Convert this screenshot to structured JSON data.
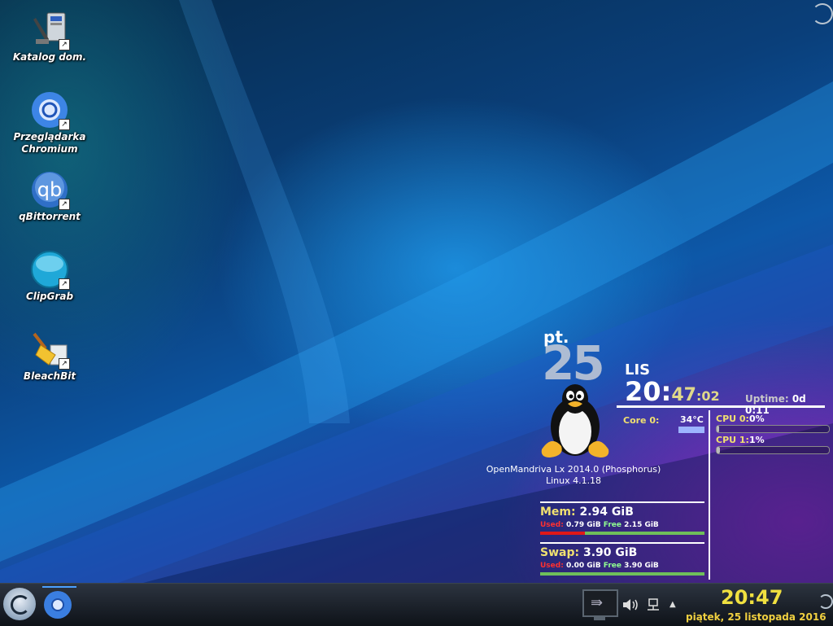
{
  "desktop": {
    "icons": [
      {
        "label_1": "Katalog dom.",
        "label_2": ""
      },
      {
        "label_1": "Przeglądarka",
        "label_2": "Chromium"
      },
      {
        "label_1": "qBittorrent",
        "label_2": ""
      },
      {
        "label_1": "ClipGrab",
        "label_2": ""
      },
      {
        "label_1": "BleachBit",
        "label_2": ""
      }
    ]
  },
  "conky": {
    "day_abbr": "pt.",
    "day_num": "25",
    "month": "LIS",
    "time_hh": "20:",
    "time_mm": "47",
    "time_ss": ":02",
    "uptime_label": "Uptime:",
    "uptime_value": "0d 0:11",
    "os_name": "OpenMandriva Lx 2014.0 (Phosphorus)",
    "kernel": "Linux 4.1.18",
    "core_label": "Core 0:",
    "core_temp": "34°C",
    "cpu": [
      {
        "label": "CPU 0:",
        "value": "0%",
        "usage": 0.02
      },
      {
        "label": "CPU 1:",
        "value": "1%",
        "usage": 0.03
      }
    ],
    "mem": {
      "label": "Mem:",
      "total": "2.94 GiB",
      "used_label": "Used:",
      "used": "0.79 GiB",
      "free_label": "Free",
      "free": "2.15 GiB",
      "used_fraction": 0.27
    },
    "swap": {
      "label": "Swap:",
      "total": "3.90 GiB",
      "used_label": "Used:",
      "used": "0.00 GiB",
      "free_label": "Free",
      "free": "3.90 GiB",
      "used_fraction": 0.0
    }
  },
  "taskbar": {
    "clock": "20:47",
    "date": "piątek, 25 listopada 2016",
    "tray_arrow": "▲"
  },
  "icons": {
    "volume": "volume-icon",
    "network": "network-icon",
    "show_hidden": "chevron-up-icon"
  },
  "colors": {
    "accent_yellow": "#f0e040",
    "used_red": "#e01818",
    "free_green": "#6fbf5a"
  }
}
